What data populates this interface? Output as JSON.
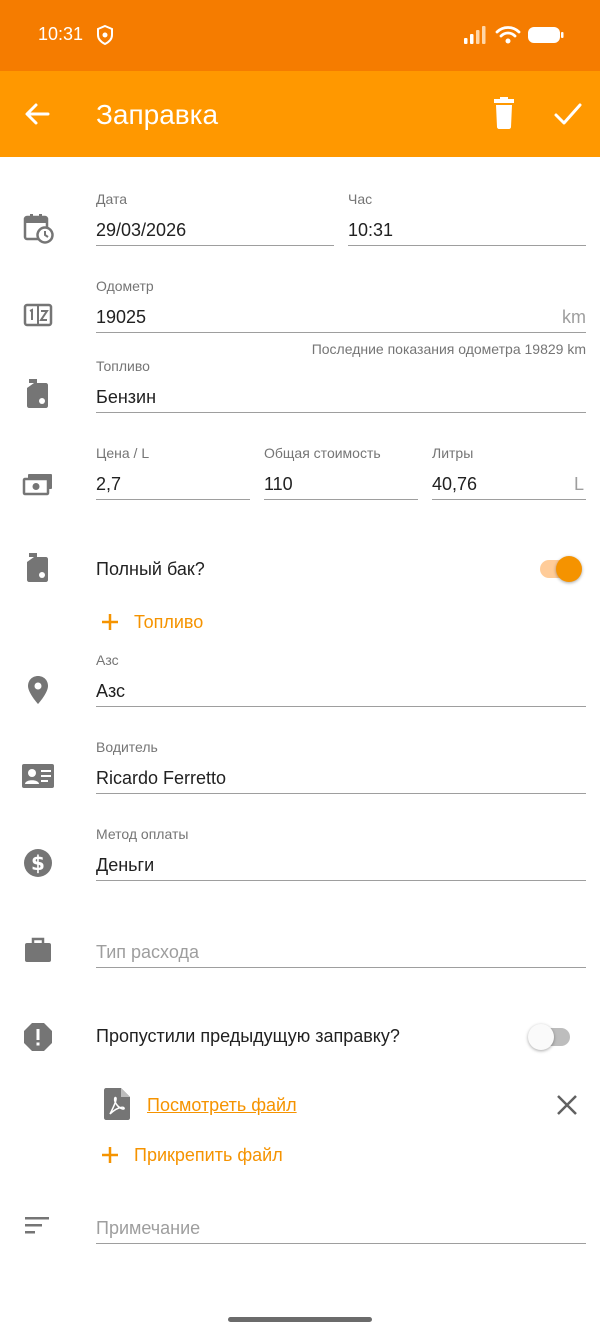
{
  "status": {
    "time": "10:31"
  },
  "appbar": {
    "title": "Заправка"
  },
  "form": {
    "date": {
      "label": "Дата",
      "value": "29/03/2026"
    },
    "time": {
      "label": "Час",
      "value": "10:31"
    },
    "odometer": {
      "label": "Одометр",
      "value": "19025",
      "unit": "km",
      "helper": "Последние показания одометра 19829 km"
    },
    "fuel": {
      "label": "Топливо",
      "value": "Бензин"
    },
    "price": {
      "label": "Цена / L",
      "value": "2,7"
    },
    "total": {
      "label": "Общая стоимость",
      "value": "110"
    },
    "liters": {
      "label": "Литры",
      "value": "40,76",
      "unit": "L"
    },
    "full_tank": {
      "label": "Полный бак?",
      "checked": true
    },
    "add_fuel": {
      "label": "Топливо"
    },
    "station": {
      "label": "Азс",
      "value": "Азс"
    },
    "driver": {
      "label": "Водитель",
      "value": "Ricardo Ferretto"
    },
    "payment": {
      "label": "Метод оплаты",
      "value": "Деньги"
    },
    "expense_type": {
      "placeholder": "Тип расхода"
    },
    "missed": {
      "label": "Пропустили предыдущую заправку?",
      "checked": false
    },
    "file": {
      "link": "Посмотреть файл"
    },
    "attach": {
      "label": "Прикрепить файл"
    },
    "notes": {
      "placeholder": "Примечание"
    }
  },
  "colors": {
    "statusbar": "#f57c00",
    "appbar": "#ff9800",
    "accent": "#f59300",
    "icon_gray": "#757575"
  },
  "icons": [
    "arrow-back-icon",
    "delete-icon",
    "check-icon",
    "calendar-clock-icon",
    "odometer-icon",
    "fuel-icon",
    "money-icon",
    "location-icon",
    "id-card-icon",
    "dollar-icon",
    "briefcase-icon",
    "alert-octagon-icon",
    "pdf-file-icon",
    "close-icon",
    "plus-icon",
    "sort-lines-icon"
  ]
}
